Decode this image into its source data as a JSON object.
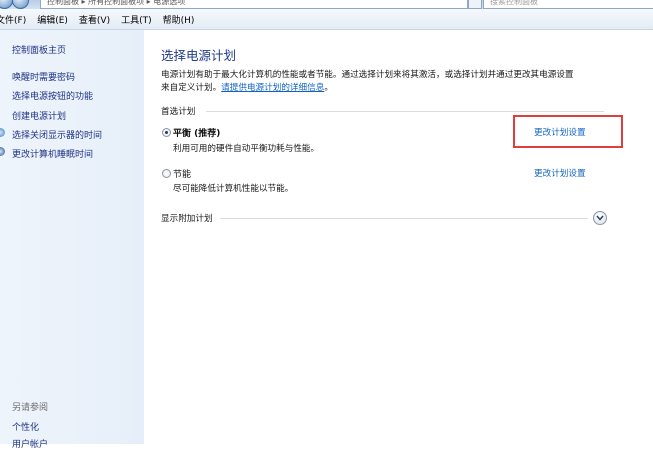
{
  "address": {
    "path": "控制面板 ▸ 所有控制面板项 ▸ 电源选项",
    "search_placeholder": "搜索控制面板"
  },
  "menu": [
    "文件(F)",
    "编辑(E)",
    "查看(V)",
    "工具(T)",
    "帮助(H)"
  ],
  "sidebar": {
    "home": "控制面板主页",
    "links": [
      "唤醒时需要密码",
      "选择电源按钮的功能",
      "创建电源计划",
      "选择关闭显示器的时间",
      "更改计算机睡眠时间"
    ],
    "see_also": "另请参阅",
    "see_also_links": [
      "个性化",
      "用户帐户"
    ]
  },
  "main": {
    "title": "选择电源计划",
    "desc_line1": "电源计划有助于最大化计算机的性能或者节能。通过选择计划来将其激活，或选择计划并通过更改其电源设置",
    "desc_line2": "来自定义计划。",
    "desc_link": "请提供电源计划的详细信息",
    "desc_end": "。",
    "preferred_group": "首选计划",
    "plans": [
      {
        "name": "平衡 (推荐)",
        "desc": "利用可用的硬件自动平衡功耗与性能。",
        "selected": true,
        "change": "更改计划设置"
      },
      {
        "name": "节能",
        "desc": "尽可能降低计算机性能以节能。",
        "selected": false,
        "change": "更改计划设置"
      }
    ],
    "show_more": "显示附加计划"
  },
  "colors": {
    "highlight_box": "#e03d3d",
    "link": "#0f62c6",
    "title": "#1e3a8a"
  }
}
